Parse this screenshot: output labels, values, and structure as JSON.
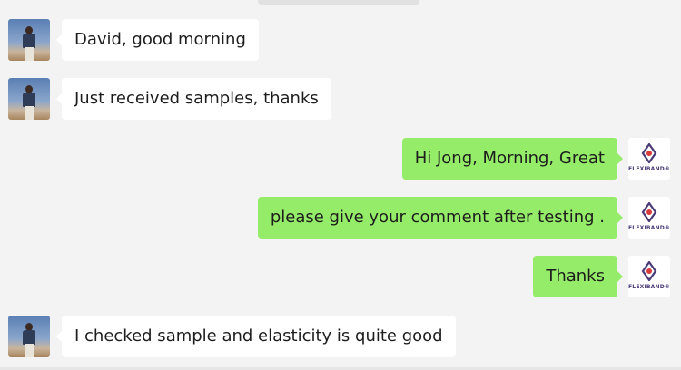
{
  "chat": {
    "messages": [
      {
        "direction": "incoming",
        "sender": "person-avatar",
        "text": "David, good morning"
      },
      {
        "direction": "incoming",
        "sender": "person-avatar",
        "text": "Just received samples, thanks"
      },
      {
        "direction": "outgoing",
        "sender": "flexiband-avatar",
        "text": "Hi Jong, Morning, Great"
      },
      {
        "direction": "outgoing",
        "sender": "flexiband-avatar",
        "text": "please give your comment after testing ."
      },
      {
        "direction": "outgoing",
        "sender": "flexiband-avatar",
        "text": "Thanks"
      },
      {
        "direction": "incoming",
        "sender": "person-avatar",
        "text": "I checked sample and elasticity is quite good"
      }
    ]
  },
  "brand": {
    "logo_text": "FLEXIBAND",
    "logo_mark": "®"
  },
  "colors": {
    "background": "#f3f3f3",
    "incoming_bubble": "#ffffff",
    "outgoing_bubble": "#95ec69",
    "text": "#1d1d1d",
    "logo_primary": "#4a3b78",
    "logo_accent": "#d93a3a"
  }
}
